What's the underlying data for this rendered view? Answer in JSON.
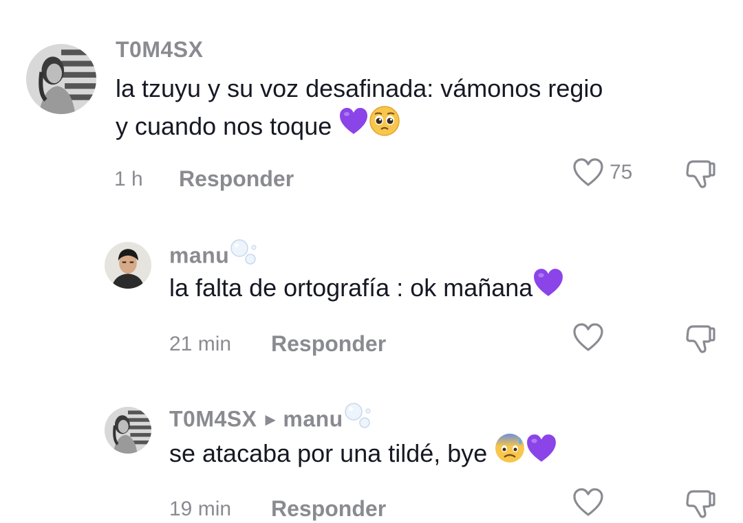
{
  "comments": [
    {
      "username": "T0M4SX",
      "text_line1": "la tzuyu y su voz desafinada: vámonos regio",
      "text_line2": "y cuando nos toque",
      "time": "1 h",
      "reply_label": "Responder",
      "likes": "75"
    },
    {
      "username": "manu",
      "text": "la falta de ortografía : ok mañana",
      "time": "21 min",
      "reply_label": "Responder"
    },
    {
      "username": "T0M4SX",
      "reply_to": "manu",
      "text": "se atacaba por una tildé, bye",
      "time": "19 min",
      "reply_label": "Responder"
    }
  ],
  "icons": {
    "like": "heart-outline-icon",
    "dislike": "thumbs-down-outline-icon",
    "purple_heart": "purple-heart-emoji",
    "pleading_face": "pleading-face-emoji",
    "anxious_face": "anxious-sweat-face-emoji",
    "bubbles": "bubbles-emoji"
  },
  "colors": {
    "text": "#161823",
    "muted": "#8a8b91",
    "purple_heart": "#8b44e8"
  }
}
